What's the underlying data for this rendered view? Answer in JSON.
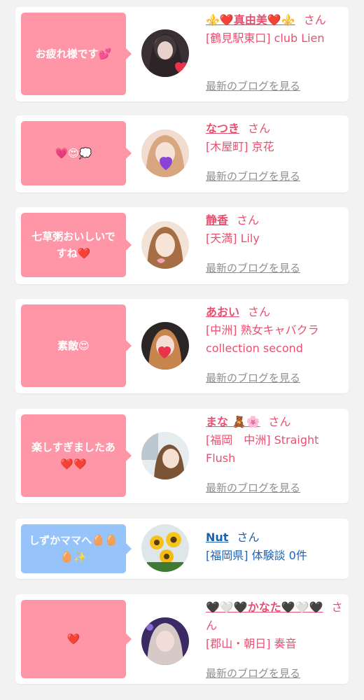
{
  "honorific": "さん",
  "blog_link_label": "最新のブログを見る",
  "colors": {
    "bubble_pink": "#ff96a8",
    "bubble_blue": "#97c3fb",
    "name_pink": "#e8506f",
    "name_blue": "#1b63b1",
    "link_gray": "#8f8f8f",
    "background": "#f2f2f2"
  },
  "comments": [
    {
      "message": "お疲れ様です💕",
      "name": "⚜️❤️真由美❤️⚜️",
      "shop": "[鶴見駅東口] club Lien",
      "show_blog_link": true,
      "style": "pink"
    },
    {
      "message": "💗😍💭",
      "name": "なつき",
      "shop": "[木屋町] 京花",
      "show_blog_link": true,
      "style": "pink"
    },
    {
      "message": "七草粥おいしいですね❤️",
      "name": "静香",
      "shop": "[天満] Lily",
      "show_blog_link": true,
      "style": "pink"
    },
    {
      "message": "素敵😍",
      "name": "あおい",
      "shop": "[中洲] 熟女キャバクラ collection second",
      "show_blog_link": true,
      "style": "pink"
    },
    {
      "message": "楽しすぎましたあ❤️❤️",
      "name": "まな 🧸🌸",
      "shop": "[福岡　中洲] Straight Flush",
      "show_blog_link": true,
      "style": "pink"
    },
    {
      "message": "しずかママへ🥚🥚🥚✨",
      "name": "Nut",
      "shop": "[福岡県] 体験談 0件",
      "show_blog_link": false,
      "style": "blue"
    },
    {
      "message": "❤️",
      "name": "🖤🤍🖤かなた🖤🤍🖤",
      "shop": "[郡山・朝日] 奏音",
      "show_blog_link": true,
      "style": "pink"
    }
  ]
}
